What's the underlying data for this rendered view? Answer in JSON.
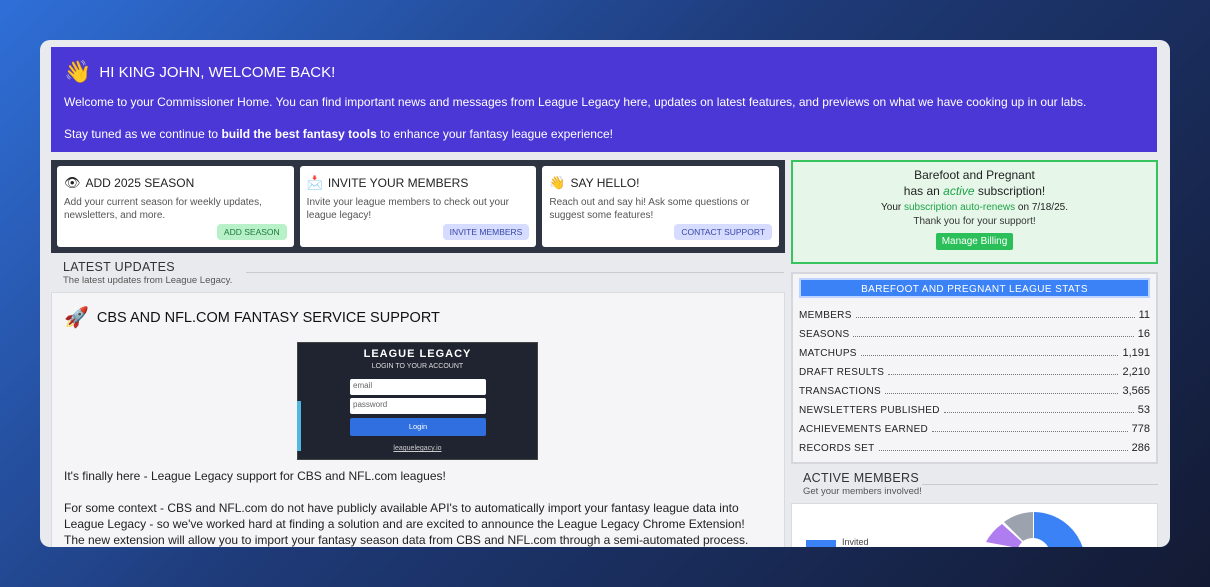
{
  "hero": {
    "title": "HI KING JOHN, WELCOME BACK!",
    "line1": "Welcome to your Commissioner Home. You can find important news and messages from League Legacy here, updates on latest features, and previews on what we have cooking up in our labs.",
    "line2_pre": "Stay tuned as we continue to ",
    "line2_bold": "build the best fantasy tools",
    "line2_post": " to enhance your fantasy league experience!"
  },
  "actions": [
    {
      "icon": "eye-icon",
      "glyph": "👁",
      "title": "ADD 2025 SEASON",
      "desc": "Add your current season for weekly updates, newsletters, and more.",
      "button": "ADD SEASON"
    },
    {
      "icon": "mail-icon",
      "glyph": "📩",
      "title": "INVITE YOUR MEMBERS",
      "desc": "Invite your league members to check out your league legacy!",
      "button": "INVITE MEMBERS"
    },
    {
      "icon": "wave-icon",
      "glyph": "👋",
      "title": "SAY HELLO!",
      "desc": "Reach out and say hi! Ask some questions or suggest some features!",
      "button": "CONTACT SUPPORT"
    }
  ],
  "latest": {
    "title": "LATEST UPDATES",
    "subtitle": "The latest updates from League Legacy.",
    "post_title": "CBS AND NFL.COM FANTASY SERVICE SUPPORT",
    "p1": "It's finally here - League Legacy support for CBS and NFL.com leagues!",
    "p2": "For some context - CBS and NFL.com do not have publicly available API's to automatically import your fantasy league data into League Legacy - so we've worked hard at finding a solution and are excited to announce the League Legacy Chrome Extension! The new extension will allow you to import your fantasy season data from CBS and NFL.com through a semi-automated process."
  },
  "login_image": {
    "brand": "LEAGUE LEGACY",
    "subtitle": "LOGIN TO YOUR ACCOUNT",
    "email_placeholder": "email",
    "password_placeholder": "password",
    "button": "Login",
    "link": "leaguelegacy.io"
  },
  "subscription": {
    "league": "Barefoot and Pregnant",
    "has_an": "has an ",
    "active": "active",
    "subscription": " subscription!",
    "your": "Your ",
    "renews": "subscription auto-renews",
    "on_date": " on 7/18/25.",
    "thanks": "Thank you for your support!",
    "button": "Manage Billing"
  },
  "stats": {
    "title": "BAREFOOT AND PREGNANT LEAGUE STATS",
    "rows": [
      {
        "label": "MEMBERS",
        "value": "11"
      },
      {
        "label": "SEASONS",
        "value": "16"
      },
      {
        "label": "MATCHUPS",
        "value": "1,191"
      },
      {
        "label": "DRAFT RESULTS",
        "value": "2,210"
      },
      {
        "label": "TRANSACTIONS",
        "value": "3,565"
      },
      {
        "label": "NEWSLETTERS PUBLISHED",
        "value": "53"
      },
      {
        "label": "ACHIEVEMENTS EARNED",
        "value": "778"
      },
      {
        "label": "RECORDS SET",
        "value": "286"
      }
    ]
  },
  "members": {
    "title": "ACTIVE MEMBERS",
    "subtitle": "Get your members involved!",
    "legend_label": "Invited"
  },
  "colors": {
    "hero": "#4a37d6",
    "accent_blue": "#3b82f6",
    "green": "#2bbf59",
    "donut": [
      "#3b82f6",
      "#b07df0",
      "#9ca3af"
    ]
  }
}
